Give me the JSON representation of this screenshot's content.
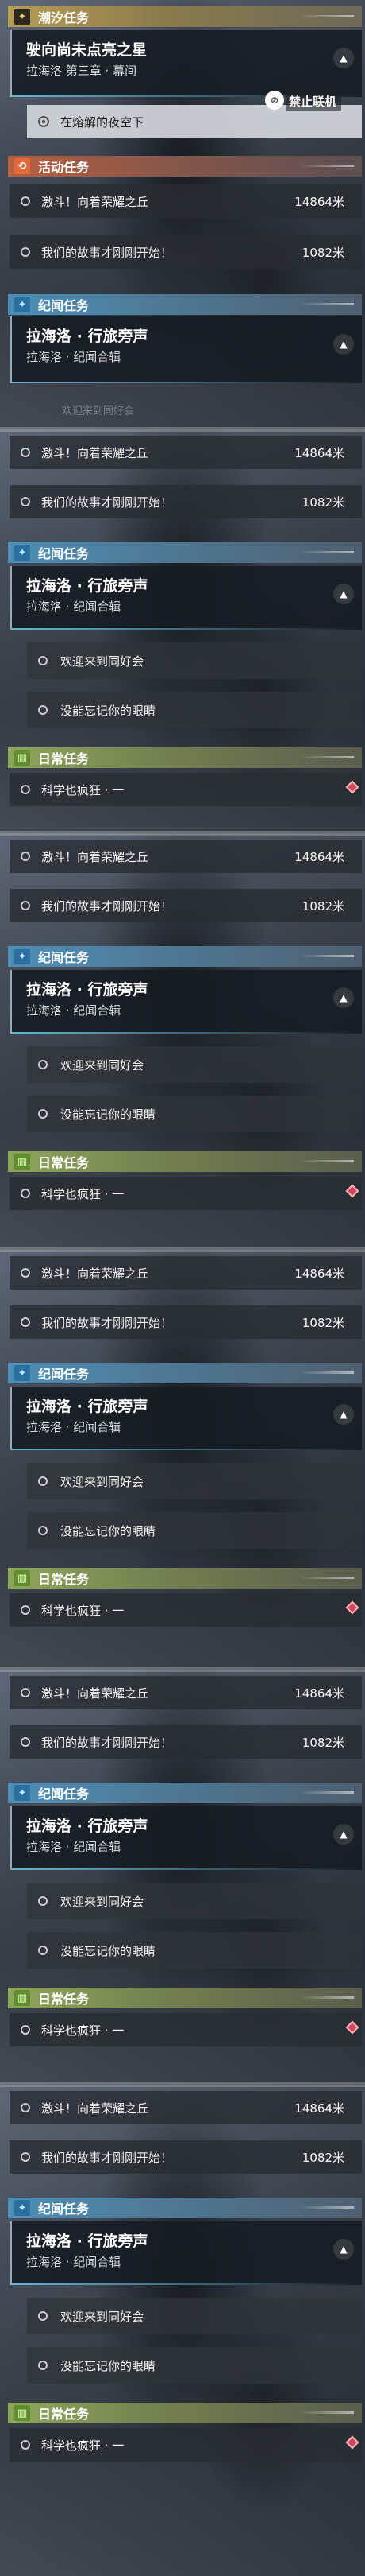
{
  "sections": {
    "tide": {
      "label": "潮汐任务",
      "icon": "star-icon",
      "color": "#b79c55"
    },
    "event": {
      "label": "活动任务",
      "icon": "event-icon",
      "color": "#b85f3f"
    },
    "story": {
      "label": "纪闻任务",
      "icon": "star-icon",
      "color": "#4d8fb8"
    },
    "daily": {
      "label": "日常任务",
      "icon": "book-icon",
      "color": "#8ea65a"
    }
  },
  "tide_quest": {
    "title": "驶向尚未点亮之星",
    "subtitle": "拉海洛 第三章 · 幕间",
    "objective": "在熔解的夜空下"
  },
  "event_quests": [
    {
      "name": "激斗！向着荣耀之丘",
      "distance": "14864米"
    },
    {
      "name": "我们的故事才刚刚开始！",
      "distance": "1082米"
    }
  ],
  "story_quest": {
    "title": "拉海洛 · 行旅旁声",
    "subtitle": "拉海洛 · 纪闻合辑",
    "objectives": [
      "欢迎来到同好会",
      "没能忘记你的眼睛"
    ]
  },
  "daily_quest": {
    "name": "科学也疯狂 · 一"
  },
  "ban_label": "禁止联机",
  "faded_text": "欢迎来到同好会"
}
